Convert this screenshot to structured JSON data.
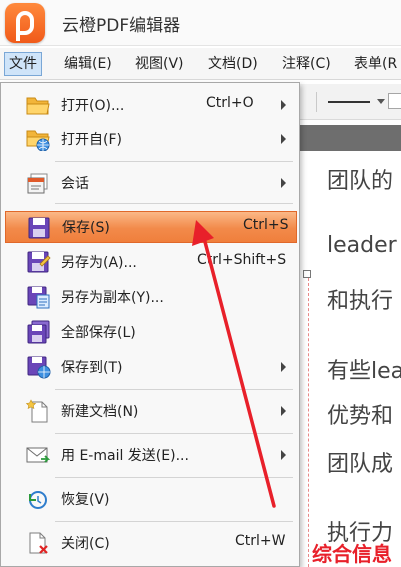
{
  "app": {
    "title": "云橙PDF编辑器"
  },
  "menubar": {
    "items": [
      {
        "label": "文件",
        "active": true
      },
      {
        "label": "编辑(E)"
      },
      {
        "label": "视图(V)"
      },
      {
        "label": "文档(D)"
      },
      {
        "label": "注释(C)"
      },
      {
        "label": "表单(R"
      }
    ]
  },
  "file_menu": {
    "items": [
      {
        "label": "打开(O)...",
        "shortcut": "Ctrl+O",
        "submenu": true,
        "icon": "folder-open-icon"
      },
      {
        "label": "打开自(F)",
        "submenu": true,
        "icon": "folder-web-icon"
      },
      {
        "label": "会话",
        "submenu": true,
        "icon": "session-icon"
      },
      {
        "label": "保存(S)",
        "shortcut": "Ctrl+S",
        "highlighted": true,
        "icon": "save-icon"
      },
      {
        "label": "另存为(A)...",
        "shortcut": "Ctrl+Shift+S",
        "icon": "save-as-icon"
      },
      {
        "label": "另存为副本(Y)...",
        "icon": "save-copy-icon"
      },
      {
        "label": "全部保存(L)",
        "icon": "save-all-icon"
      },
      {
        "label": "保存到(T)",
        "submenu": true,
        "icon": "save-to-icon"
      },
      {
        "label": "新建文档(N)",
        "submenu": true,
        "icon": "new-document-icon"
      },
      {
        "label": "用 E-mail 发送(E)...",
        "submenu": true,
        "icon": "email-icon"
      },
      {
        "label": "恢复(V)",
        "icon": "restore-icon"
      },
      {
        "label": "关闭(C)",
        "shortcut": "Ctrl+W",
        "icon": "close-document-icon"
      }
    ]
  },
  "document": {
    "lines": [
      "团队的",
      "leader",
      "和执行",
      "有些lea",
      "优势和",
      "团队成",
      "执行力"
    ]
  },
  "watermark": "综合信息",
  "colors": {
    "highlight": "#f28a4a",
    "accent": "#f05a1a",
    "annotation": "#e8202a"
  }
}
